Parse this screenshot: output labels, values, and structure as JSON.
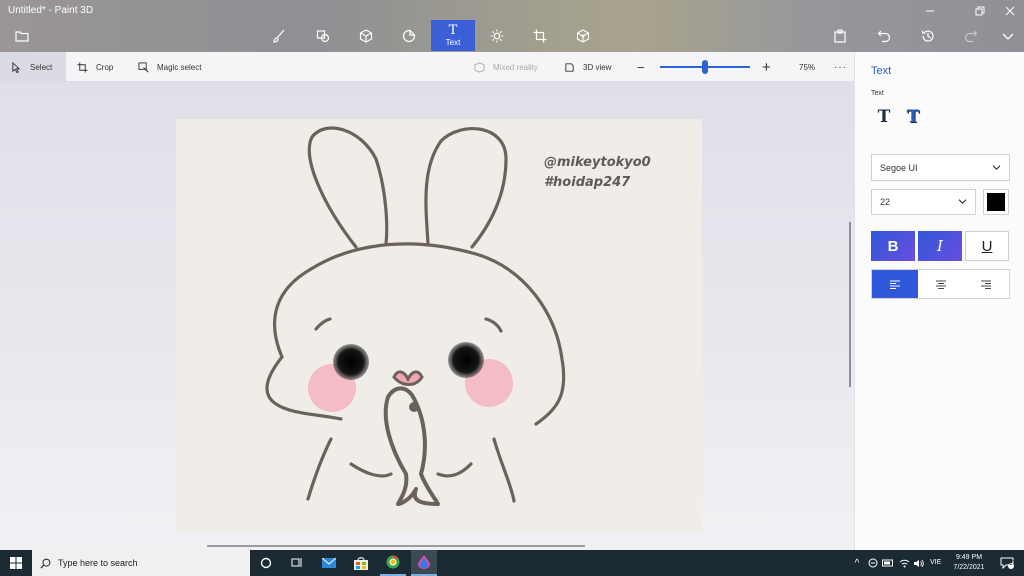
{
  "window": {
    "title": "Untitled* - Paint 3D"
  },
  "toolbar": {
    "active_tab_label": "Text",
    "tools": [
      "brushes",
      "2d-shapes",
      "3d-shapes",
      "stickers",
      "text",
      "effects",
      "canvas",
      "3d-library"
    ]
  },
  "subbar": {
    "select_label": "Select",
    "crop_label": "Crop",
    "magic_select_label": "Magic select",
    "mixed_reality_label": "Mixed reality",
    "view_3d_label": "3D view",
    "zoom_value": "75%",
    "zoom_level": 0.5
  },
  "canvas": {
    "watermark_line1": "@mikeytokyo0",
    "watermark_line2": "#hoidap247"
  },
  "panel": {
    "title": "Text",
    "subtitle": "Text",
    "font_family": "Segoe UI",
    "font_size": "22",
    "text_color": "#000000",
    "bold_label": "B",
    "italic_label": "I",
    "underline_label": "U",
    "accent_color": "#2f58d8"
  },
  "taskbar": {
    "search_placeholder": "Type here to search",
    "language": "VIE",
    "time": "9:49 PM",
    "date": "7/22/2021",
    "notification_count": "17"
  }
}
